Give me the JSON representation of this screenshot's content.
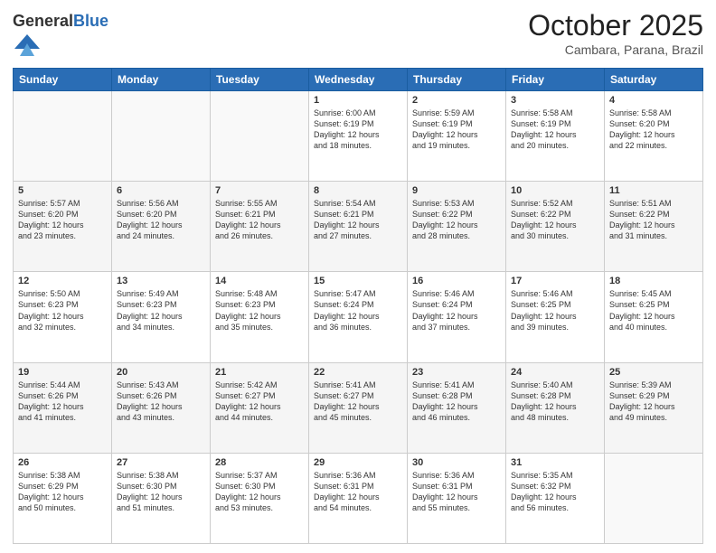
{
  "header": {
    "logo_general": "General",
    "logo_blue": "Blue",
    "month_title": "October 2025",
    "location": "Cambara, Parana, Brazil"
  },
  "days_of_week": [
    "Sunday",
    "Monday",
    "Tuesday",
    "Wednesday",
    "Thursday",
    "Friday",
    "Saturday"
  ],
  "weeks": [
    [
      {
        "day": "",
        "info": ""
      },
      {
        "day": "",
        "info": ""
      },
      {
        "day": "",
        "info": ""
      },
      {
        "day": "1",
        "info": "Sunrise: 6:00 AM\nSunset: 6:19 PM\nDaylight: 12 hours\nand 18 minutes."
      },
      {
        "day": "2",
        "info": "Sunrise: 5:59 AM\nSunset: 6:19 PM\nDaylight: 12 hours\nand 19 minutes."
      },
      {
        "day": "3",
        "info": "Sunrise: 5:58 AM\nSunset: 6:19 PM\nDaylight: 12 hours\nand 20 minutes."
      },
      {
        "day": "4",
        "info": "Sunrise: 5:58 AM\nSunset: 6:20 PM\nDaylight: 12 hours\nand 22 minutes."
      }
    ],
    [
      {
        "day": "5",
        "info": "Sunrise: 5:57 AM\nSunset: 6:20 PM\nDaylight: 12 hours\nand 23 minutes."
      },
      {
        "day": "6",
        "info": "Sunrise: 5:56 AM\nSunset: 6:20 PM\nDaylight: 12 hours\nand 24 minutes."
      },
      {
        "day": "7",
        "info": "Sunrise: 5:55 AM\nSunset: 6:21 PM\nDaylight: 12 hours\nand 26 minutes."
      },
      {
        "day": "8",
        "info": "Sunrise: 5:54 AM\nSunset: 6:21 PM\nDaylight: 12 hours\nand 27 minutes."
      },
      {
        "day": "9",
        "info": "Sunrise: 5:53 AM\nSunset: 6:22 PM\nDaylight: 12 hours\nand 28 minutes."
      },
      {
        "day": "10",
        "info": "Sunrise: 5:52 AM\nSunset: 6:22 PM\nDaylight: 12 hours\nand 30 minutes."
      },
      {
        "day": "11",
        "info": "Sunrise: 5:51 AM\nSunset: 6:22 PM\nDaylight: 12 hours\nand 31 minutes."
      }
    ],
    [
      {
        "day": "12",
        "info": "Sunrise: 5:50 AM\nSunset: 6:23 PM\nDaylight: 12 hours\nand 32 minutes."
      },
      {
        "day": "13",
        "info": "Sunrise: 5:49 AM\nSunset: 6:23 PM\nDaylight: 12 hours\nand 34 minutes."
      },
      {
        "day": "14",
        "info": "Sunrise: 5:48 AM\nSunset: 6:23 PM\nDaylight: 12 hours\nand 35 minutes."
      },
      {
        "day": "15",
        "info": "Sunrise: 5:47 AM\nSunset: 6:24 PM\nDaylight: 12 hours\nand 36 minutes."
      },
      {
        "day": "16",
        "info": "Sunrise: 5:46 AM\nSunset: 6:24 PM\nDaylight: 12 hours\nand 37 minutes."
      },
      {
        "day": "17",
        "info": "Sunrise: 5:46 AM\nSunset: 6:25 PM\nDaylight: 12 hours\nand 39 minutes."
      },
      {
        "day": "18",
        "info": "Sunrise: 5:45 AM\nSunset: 6:25 PM\nDaylight: 12 hours\nand 40 minutes."
      }
    ],
    [
      {
        "day": "19",
        "info": "Sunrise: 5:44 AM\nSunset: 6:26 PM\nDaylight: 12 hours\nand 41 minutes."
      },
      {
        "day": "20",
        "info": "Sunrise: 5:43 AM\nSunset: 6:26 PM\nDaylight: 12 hours\nand 43 minutes."
      },
      {
        "day": "21",
        "info": "Sunrise: 5:42 AM\nSunset: 6:27 PM\nDaylight: 12 hours\nand 44 minutes."
      },
      {
        "day": "22",
        "info": "Sunrise: 5:41 AM\nSunset: 6:27 PM\nDaylight: 12 hours\nand 45 minutes."
      },
      {
        "day": "23",
        "info": "Sunrise: 5:41 AM\nSunset: 6:28 PM\nDaylight: 12 hours\nand 46 minutes."
      },
      {
        "day": "24",
        "info": "Sunrise: 5:40 AM\nSunset: 6:28 PM\nDaylight: 12 hours\nand 48 minutes."
      },
      {
        "day": "25",
        "info": "Sunrise: 5:39 AM\nSunset: 6:29 PM\nDaylight: 12 hours\nand 49 minutes."
      }
    ],
    [
      {
        "day": "26",
        "info": "Sunrise: 5:38 AM\nSunset: 6:29 PM\nDaylight: 12 hours\nand 50 minutes."
      },
      {
        "day": "27",
        "info": "Sunrise: 5:38 AM\nSunset: 6:30 PM\nDaylight: 12 hours\nand 51 minutes."
      },
      {
        "day": "28",
        "info": "Sunrise: 5:37 AM\nSunset: 6:30 PM\nDaylight: 12 hours\nand 53 minutes."
      },
      {
        "day": "29",
        "info": "Sunrise: 5:36 AM\nSunset: 6:31 PM\nDaylight: 12 hours\nand 54 minutes."
      },
      {
        "day": "30",
        "info": "Sunrise: 5:36 AM\nSunset: 6:31 PM\nDaylight: 12 hours\nand 55 minutes."
      },
      {
        "day": "31",
        "info": "Sunrise: 5:35 AM\nSunset: 6:32 PM\nDaylight: 12 hours\nand 56 minutes."
      },
      {
        "day": "",
        "info": ""
      }
    ]
  ]
}
